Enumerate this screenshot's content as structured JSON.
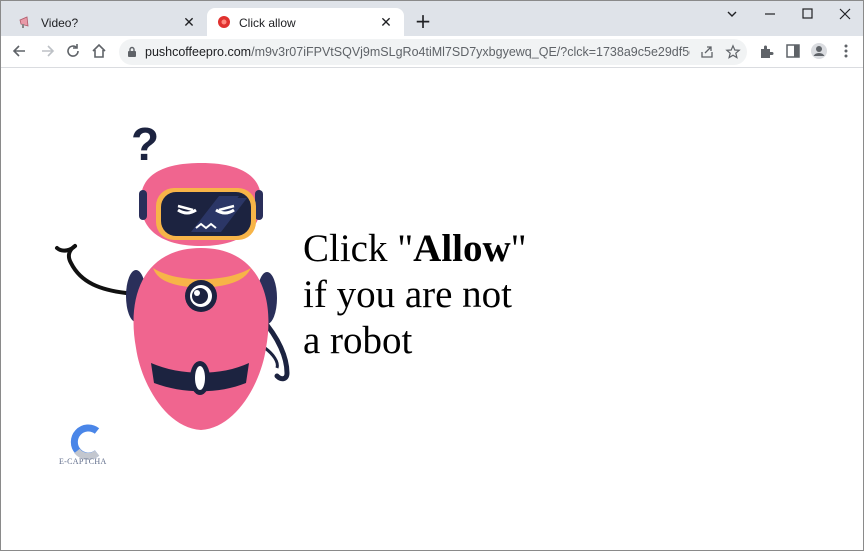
{
  "browser": {
    "tabs": [
      {
        "title": "Video?",
        "active": false,
        "favicon": "megaphone-icon"
      },
      {
        "title": "Click allow",
        "active": true,
        "favicon": "red-circle-icon"
      }
    ],
    "new_tab": "+",
    "address": {
      "host": "pushcoffeepro.com",
      "path": "/m9v3r07iFPVtSQVj9mSLgRo4tiMl7SD7yxbgyewq_QE/?clck=1738a9c5e29df5d8ffe2e3..."
    }
  },
  "page": {
    "line1_prefix": "Click \"",
    "line1_bold": "Allow",
    "line1_suffix": "\"",
    "line2": "if you are not",
    "line3": "a robot",
    "captcha_label": "E-CAPTCHA"
  },
  "colors": {
    "robot_body": "#f0658f",
    "robot_collar": "#f7b448",
    "robot_dark": "#1c2340",
    "accent_blue": "#4a86e8"
  }
}
